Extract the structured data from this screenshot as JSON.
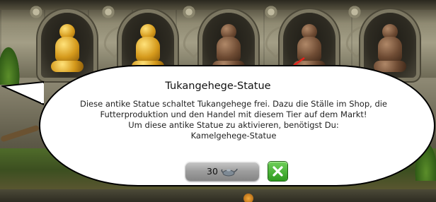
{
  "dialog": {
    "title": "Tukangehege-Statue",
    "lines": [
      "Diese antike Statue schaltet Tukangehege frei. Dazu die Ställe im Shop, die",
      "Futterproduktion und den Handel mit diesem Tier auf dem Markt!",
      "Um diese antike Statue zu aktivieren, benötigst Du:",
      "Kamelgehege-Statue"
    ]
  },
  "buy_button": {
    "amount": "30",
    "currency_icon": "magic-lamp-icon"
  },
  "close_button": {
    "icon": "close-x-icon",
    "color": "#3cae29"
  },
  "statues": [
    {
      "state": "gold"
    },
    {
      "state": "gold"
    },
    {
      "state": "bronze"
    },
    {
      "state": "bronze"
    },
    {
      "state": "bronze"
    }
  ],
  "pointer_color": "#e8201a"
}
